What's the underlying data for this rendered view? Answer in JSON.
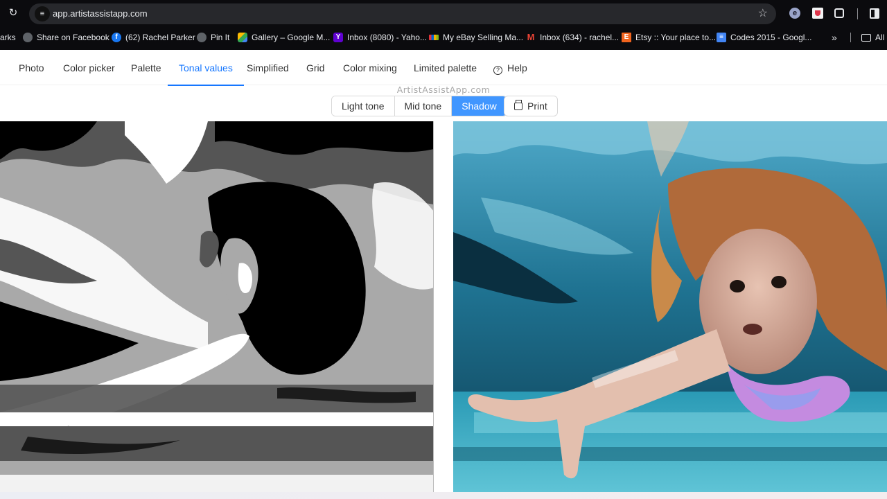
{
  "browser": {
    "url": "app.artistassistapp.com",
    "icons": {
      "reload": "reload-icon",
      "site_info": "site-info-icon",
      "bookmark_star": "star-icon",
      "extensions": [
        "e-extension-icon",
        "pocket-icon",
        "puzzle-extensions-icon",
        "side-panel-icon"
      ]
    },
    "bookmarks": [
      {
        "label": "arks",
        "icon": "none"
      },
      {
        "label": "Share on Facebook",
        "icon": "globe-icon"
      },
      {
        "label": "(62) Rachel Parker",
        "icon": "facebook-icon"
      },
      {
        "label": "Pin It",
        "icon": "globe-icon"
      },
      {
        "label": "Gallery – Google M...",
        "icon": "google-maps-icon"
      },
      {
        "label": "Inbox (8080) - Yaho...",
        "icon": "yahoo-icon"
      },
      {
        "label": "My eBay Selling Ma...",
        "icon": "ebay-icon"
      },
      {
        "label": "Inbox (634) - rachel...",
        "icon": "gmail-icon"
      },
      {
        "label": "Etsy :: Your place to...",
        "icon": "etsy-icon"
      },
      {
        "label": "Codes 2015 - Googl...",
        "icon": "google-docs-icon"
      }
    ],
    "more_bookmarks": "»",
    "all_bookmarks": "All"
  },
  "nav": {
    "tabs": [
      {
        "label": "Photo",
        "active": false
      },
      {
        "label": "Color picker",
        "active": false
      },
      {
        "label": "Palette",
        "active": false
      },
      {
        "label": "Tonal values",
        "active": true
      },
      {
        "label": "Simplified",
        "active": false
      },
      {
        "label": "Grid",
        "active": false
      },
      {
        "label": "Color mixing",
        "active": false
      },
      {
        "label": "Limited palette",
        "active": false
      },
      {
        "label": "Help",
        "active": false,
        "icon": "question-circle-icon"
      }
    ]
  },
  "main": {
    "watermark": "ArtistAssistApp.com",
    "tone_selector": {
      "options": [
        "Light tone",
        "Mid tone",
        "Shadow"
      ],
      "selected": "Shadow"
    },
    "print_label": "Print",
    "images": {
      "left": "Tonal values rendering (black, dark gray, light gray, white) of girl swimming underwater",
      "right": "Original color photo of girl swimming underwater in a pool"
    }
  },
  "colors": {
    "accent": "#1677ff",
    "selected_segment": "#4096ff",
    "chrome_bg": "#0b0b0e",
    "omnibox_bg": "#27282c",
    "tones": [
      "#000000",
      "#555555",
      "#a9a9a9",
      "#ffffff"
    ]
  }
}
